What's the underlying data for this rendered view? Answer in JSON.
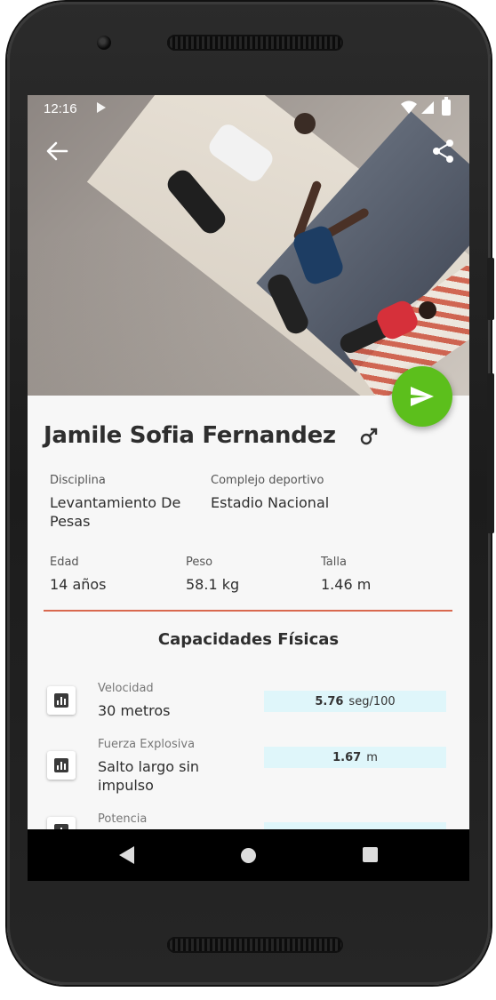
{
  "status_bar": {
    "time": "12:16"
  },
  "profile": {
    "name": "Jamile Sofia Fernandez",
    "gender_icon": "male-symbol-icon"
  },
  "fields": {
    "disciplina_label": "Disciplina",
    "disciplina_value": "Levantamiento De Pesas",
    "complejo_label": "Complejo deportivo",
    "complejo_value": "Estadio Nacional",
    "edad_label": "Edad",
    "edad_value": "14 años",
    "peso_label": "Peso",
    "peso_value": "58.1 kg",
    "talla_label": "Talla",
    "talla_value": "1.46 m"
  },
  "capacidades": {
    "title": "Capacidades Físicas",
    "items": [
      {
        "category": "Velocidad",
        "test": "30 metros",
        "value": "5.76",
        "unit": "seg/100"
      },
      {
        "category": "Fuerza Explosiva",
        "test": "Salto largo sin impulso",
        "value": "1.67",
        "unit": "m"
      },
      {
        "category": "Potencia",
        "test": "",
        "value": "",
        "unit": ""
      }
    ]
  },
  "colors": {
    "fab": "#5cbf1c",
    "divider": "#d9694f",
    "result_bg": "#dff6fa"
  }
}
